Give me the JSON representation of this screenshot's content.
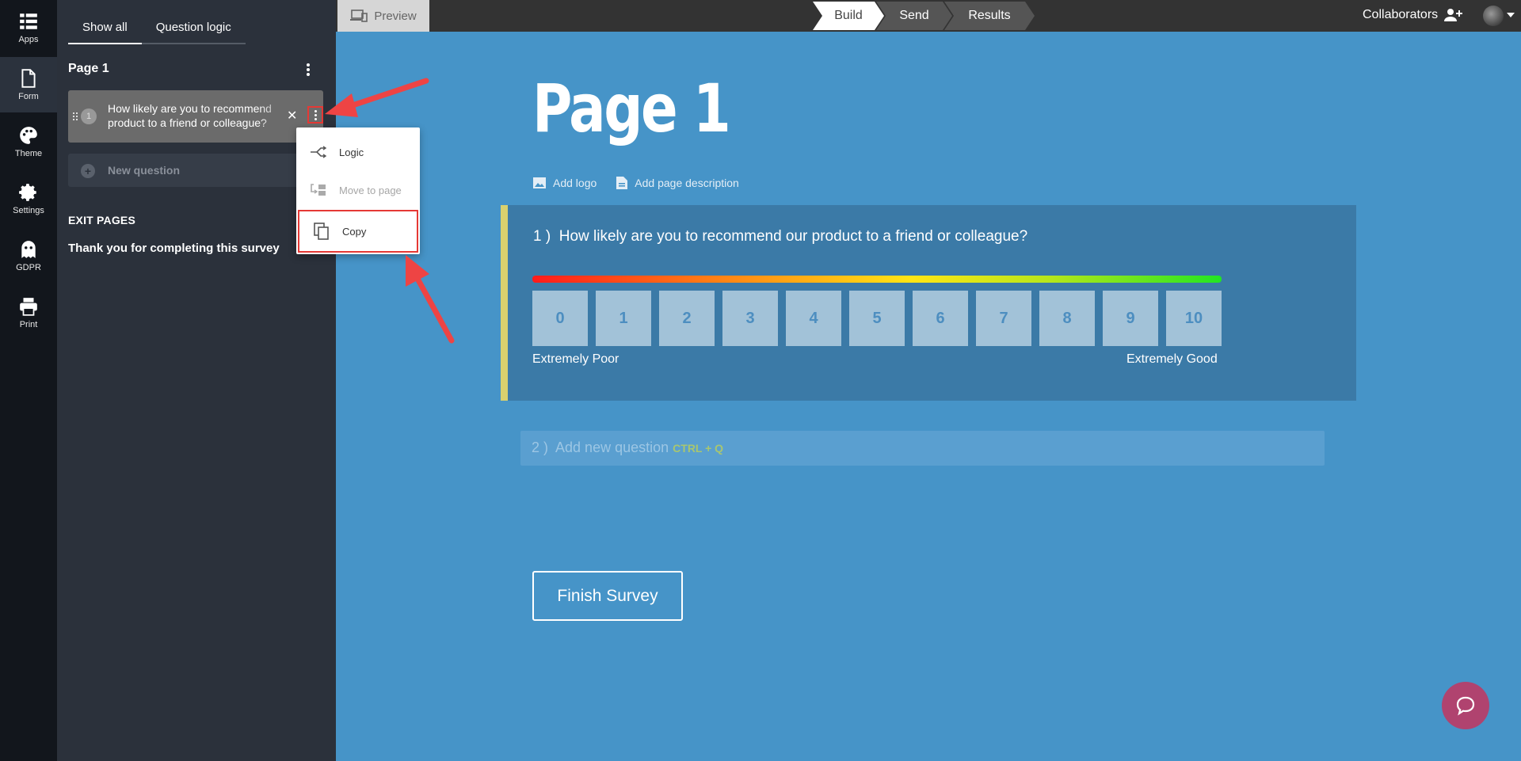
{
  "rail": {
    "items": [
      {
        "label": "Apps",
        "icon": "apps-grid-icon"
      },
      {
        "label": "Form",
        "icon": "document-icon"
      },
      {
        "label": "Theme",
        "icon": "palette-icon"
      },
      {
        "label": "Settings",
        "icon": "gear-icon"
      },
      {
        "label": "GDPR",
        "icon": "ghost-icon"
      },
      {
        "label": "Print",
        "icon": "printer-icon"
      }
    ],
    "active": "Form"
  },
  "panel": {
    "tabs": [
      "Show all",
      "Question logic"
    ],
    "active_tab": "Show all",
    "page_title": "Page 1",
    "question": {
      "number": "1",
      "line1": "How likely are you to recommend our",
      "line2": "product to a friend or colleague?"
    },
    "new_question": "New question",
    "exit_pages_heading": "EXIT PAGES",
    "exit_page": "Thank you for completing this survey"
  },
  "context_menu": {
    "items": [
      {
        "label": "Logic",
        "icon": "logic-branch-icon",
        "disabled": false
      },
      {
        "label": "Move to page",
        "icon": "move-to-page-icon",
        "disabled": true
      },
      {
        "label": "Copy",
        "icon": "copy-icon",
        "disabled": false,
        "highlighted": true
      }
    ]
  },
  "topbar": {
    "preview": "Preview",
    "steps": [
      "Build",
      "Send",
      "Results"
    ],
    "active_step": "Build",
    "collaborators": "Collaborators"
  },
  "canvas": {
    "page_title": "Page 1",
    "add_logo": "Add logo",
    "add_description": "Add page description",
    "question": {
      "number": "1 )",
      "text": "How likely are you to recommend our product to a friend or colleague?",
      "scale": [
        "0",
        "1",
        "2",
        "3",
        "4",
        "5",
        "6",
        "7",
        "8",
        "9",
        "10"
      ],
      "low_label": "Extremely Poor",
      "high_label": "Extremely Good"
    },
    "add_question": {
      "number": "2 )",
      "text": "Add new question",
      "shortcut": "CTRL + Q"
    },
    "finish_button": "Finish Survey"
  },
  "colors": {
    "canvas_bg": "#4694c8",
    "panel_bg": "#2b313b",
    "highlight": "#e53935",
    "chat_button": "#b0436f"
  }
}
